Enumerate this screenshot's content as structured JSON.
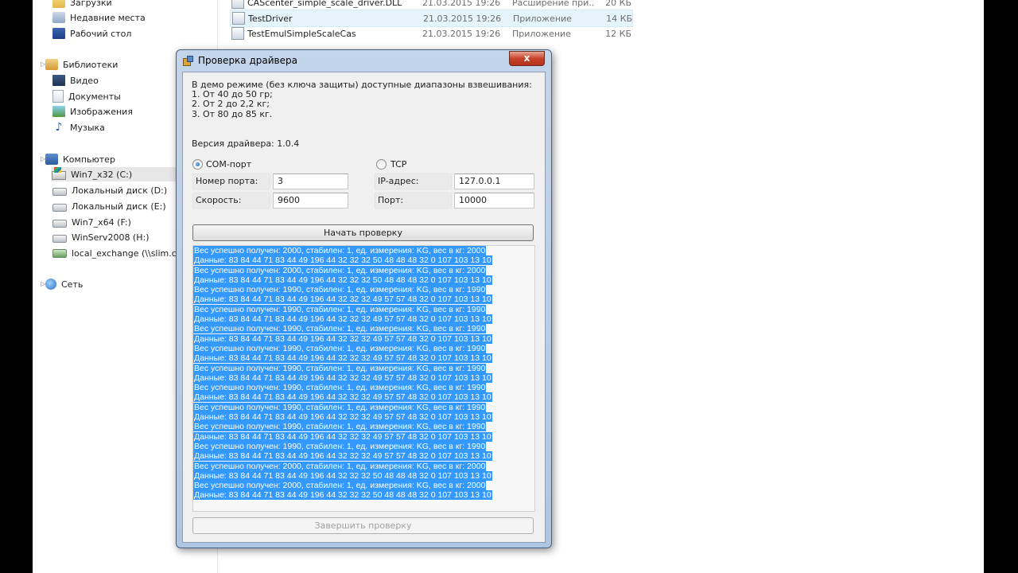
{
  "explorer": {
    "nav": {
      "downloads": "Загрузки",
      "recent": "Недавние места",
      "desktop": "Рабочий стол",
      "libraries": "Библиотеки",
      "video": "Видео",
      "documents": "Документы",
      "images": "Изображения",
      "music": "Музыка",
      "computer": "Компьютер",
      "drive_c": "Win7_x32 (C:)",
      "drive_d": "Локальный диск (D:)",
      "drive_e": "Локальный диск (E:)",
      "drive_f": "Win7_x64 (F:)",
      "drive_h": "WinServ2008 (H:)",
      "net_drive": "local_exchange (\\\\slim.cas)",
      "network": "Сеть"
    },
    "files": [
      {
        "name": "CAScenter_simple_scale_driver.DLL",
        "date": "21.03.2015 19:26",
        "type": "Расширение при...",
        "size": "20 КБ"
      },
      {
        "name": "TestDriver",
        "date": "21.03.2015 19:26",
        "type": "Приложение",
        "size": "14 КБ"
      },
      {
        "name": "TestEmulSimpleScaleCas",
        "date": "21.03.2015 19:26",
        "type": "Приложение",
        "size": "12 КБ"
      }
    ]
  },
  "dialog": {
    "title": "Проверка драйвера",
    "close_label": "x",
    "demo_text": "В демо режиме (без ключа защиты) доступные диапазоны взвешивания:",
    "range1": "1. От 40 до 50 гр;",
    "range2": "2. От 2 до 2,2 кг;",
    "range3": "3. От 80 до 85 кг.",
    "version": "Версия драйвера: 1.0.4",
    "com_label": "COM-порт",
    "tcp_label": "TCP",
    "port_number_label": "Номер порта:",
    "port_number_value": "3",
    "speed_label": "Скорость:",
    "speed_value": "9600",
    "ip_label": "IP-адрес:",
    "ip_value": "127.0.0.1",
    "port_label": "Порт:",
    "port_value": "10000",
    "start_button": "Начать проверку",
    "finish_button": "Завершить проверку",
    "log": [
      "Вес успешно получен: 2000, стабилен: 1, ед. измерения: KG, вес в кг: 2000",
      "Данные: 83 84 44 71 83 44 49 196 44 32 32 32 50 48 48 48 32 0 107 103 13 10",
      "Вес успешно получен: 2000, стабилен: 1, ед. измерения: KG, вес в кг: 2000",
      "Данные: 83 84 44 71 83 44 49 196 44 32 32 32 50 48 48 48 32 0 107 103 13 10",
      "Вес успешно получен: 1990, стабилен: 1, ед. измерения: KG, вес в кг: 1990",
      "Данные: 83 84 44 71 83 44 49 196 44 32 32 32 49 57 57 48 32 0 107 103 13 10",
      "Вес успешно получен: 1990, стабилен: 1, ед. измерения: KG, вес в кг: 1990",
      "Данные: 83 84 44 71 83 44 49 196 44 32 32 32 49 57 57 48 32 0 107 103 13 10",
      "Вес успешно получен: 1990, стабилен: 1, ед. измерения: KG, вес в кг: 1990",
      "Данные: 83 84 44 71 83 44 49 196 44 32 32 32 49 57 57 48 32 0 107 103 13 10",
      "Вес успешно получен: 1990, стабилен: 1, ед. измерения: KG, вес в кг: 1990",
      "Данные: 83 84 44 71 83 44 49 196 44 32 32 32 49 57 57 48 32 0 107 103 13 10",
      "Вес успешно получен: 1990, стабилен: 1, ед. измерения: KG, вес в кг: 1990",
      "Данные: 83 84 44 71 83 44 49 196 44 32 32 32 49 57 57 48 32 0 107 103 13 10",
      "Вес успешно получен: 1990, стабилен: 1, ед. измерения: KG, вес в кг: 1990",
      "Данные: 83 84 44 71 83 44 49 196 44 32 32 32 49 57 57 48 32 0 107 103 13 10",
      "Вес успешно получен: 1990, стабилен: 1, ед. измерения: KG, вес в кг: 1990",
      "Данные: 83 84 44 71 83 44 49 196 44 32 32 32 49 57 57 48 32 0 107 103 13 10",
      "Вес успешно получен: 1990, стабилен: 1, ед. измерения: KG, вес в кг: 1990",
      "Данные: 83 84 44 71 83 44 49 196 44 32 32 32 49 57 57 48 32 0 107 103 13 10",
      "Вес успешно получен: 1990, стабилен: 1, ед. измерения: KG, вес в кг: 1990",
      "Данные: 83 84 44 71 83 44 49 196 44 32 32 32 49 57 57 48 32 0 107 103 13 10",
      "Вес успешно получен: 2000, стабилен: 1, ед. измерения: KG, вес в кг: 2000",
      "Данные: 83 84 44 71 83 44 49 196 44 32 32 32 50 48 48 48 32 0 107 103 13 10",
      "Вес успешно получен: 2000, стабилен: 1, ед. измерения: KG, вес в кг: 2000",
      "Данные: 83 84 44 71 83 44 49 196 44 32 32 32 50 48 48 48 32 0 107 103 13 10"
    ]
  }
}
